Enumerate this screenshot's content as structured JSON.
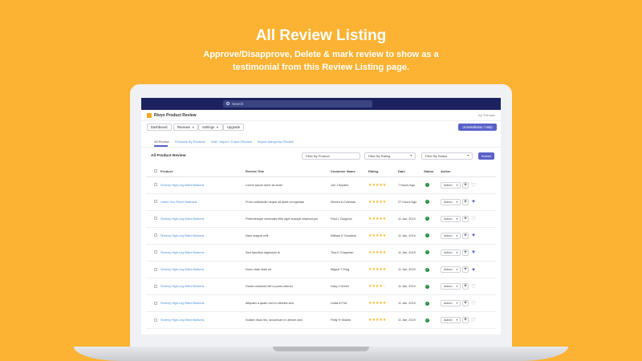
{
  "hero": {
    "title": "All Review Listing",
    "subtitle_line1": "Approve/Disapprove, Delete & mark review to show as a",
    "subtitle_line2": "testimonial from this Review Listing page."
  },
  "topbar": {
    "search_placeholder": "Search"
  },
  "app": {
    "title": "Rivyo Product Review",
    "by": "By Thimatic"
  },
  "nav": {
    "dashboard": "Dashboard",
    "reviews": "Reviews",
    "settings": "Settings",
    "upgrade": "Upgrade",
    "uninstall": "Uninstallation / Help"
  },
  "tabs": [
    "All Review",
    "Products By Reviews",
    "Add / Import / Export Review",
    "Import Aliexpress Review"
  ],
  "card": {
    "title": "All Product Review",
    "filter_product_placeholder": "Filter By Product",
    "filter_rating": "Filter By Rating",
    "filter_status": "Filter By Status",
    "submit": "Submit"
  },
  "table": {
    "headers": [
      "Product",
      "Review Title",
      "Customer Name",
      "Rating",
      "Date",
      "Status",
      "Action"
    ],
    "action_label": "Action",
    "rows": [
      {
        "product": "Sheeny High-Leg Bikini Bottoms",
        "title": "Lorem ipsum dolor sit amet",
        "customer": "Jon J Bryden",
        "rating": 5,
        "date": "7 Hours Ago",
        "fav": false
      },
      {
        "product": "Halter One-Piece Swimsuit",
        "title": "Proin sollicitudin neque sit amet mi egestas",
        "customer": "Steven A Coleman",
        "rating": 5,
        "date": "27 Hours Ago",
        "fav": true
      },
      {
        "product": "Sheeny High-Leg Bikini Bottoms",
        "title": "Pellentesque venenatis felis eget suscipit ullamcorper",
        "customer": "Paul L Claypool",
        "rating": 5,
        "date": "11 Jan, 2019",
        "fav": false
      },
      {
        "product": "Sheeny High-Leg Bikini Bottoms",
        "title": "Nam magna velit",
        "customer": "William E Goodwin",
        "rating": 5,
        "date": "11 Jan, 2019",
        "fav": true
      },
      {
        "product": "Sheeny High-Leg Bikini Bottoms",
        "title": "Sed faucibus dignissim le",
        "customer": "Tina K Chapman",
        "rating": 5,
        "date": "11 Jan, 2019",
        "fav": true
      },
      {
        "product": "Sheeny High-Leg Bikini Bottoms",
        "title": "Nunc vitae diam ult",
        "customer": "Miguel T King",
        "rating": 5,
        "date": "11 Jan, 2019",
        "fav": true
      },
      {
        "product": "Sheeny High-Leg Bikini Bottoms",
        "title": "Donec euismod elit a purus interdu",
        "customer": "Gary J Green",
        "rating": 4,
        "date": "11 Jan, 2019",
        "fav": false
      },
      {
        "product": "Sheeny High-Leg Bikini Bottoms",
        "title": "Aliquam a quam orci in ultricies sed",
        "customer": "Linda A Fort",
        "rating": 5,
        "date": "11 Jan, 2019",
        "fav": false
      },
      {
        "product": "Sheeny High-Leg Bikini Bottoms",
        "title": "Nullam risus leo, accumsan in ultrices sed",
        "customer": "Patty H Stokes",
        "rating": 5,
        "date": "11 Jan, 2019",
        "fav": false
      }
    ]
  },
  "colors": {
    "background": "#fcb232",
    "topbar": "#1c2260",
    "accent": "#5a60c8",
    "link": "#4a90d9",
    "star": "#f5b821",
    "status_ok": "#1e8c3a"
  }
}
